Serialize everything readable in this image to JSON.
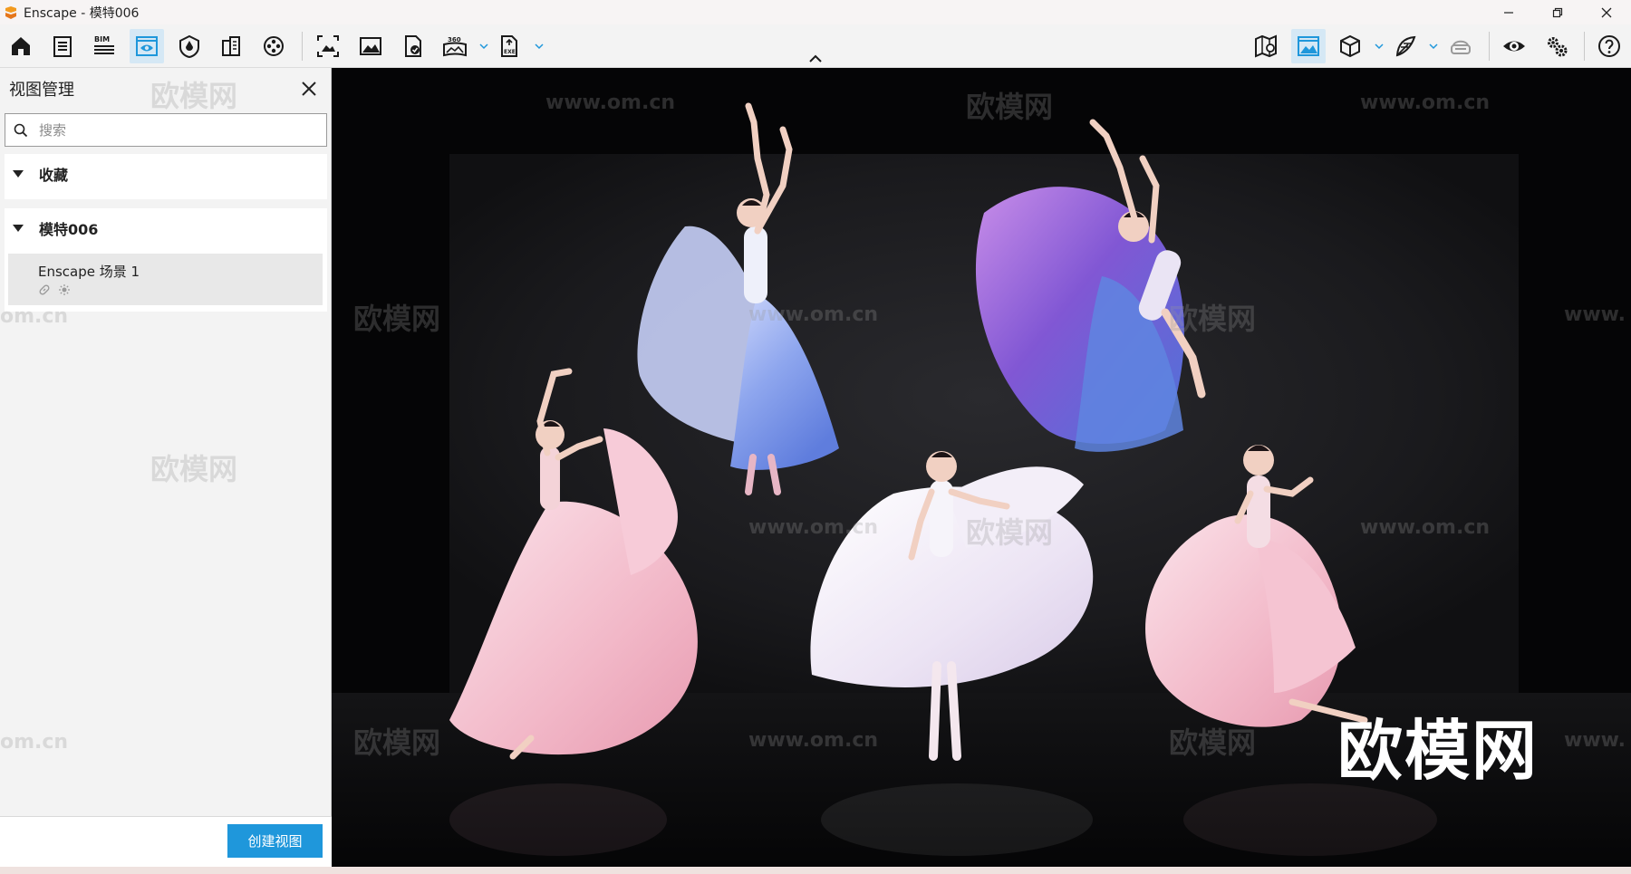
{
  "window": {
    "title": "Enscape - 模特006"
  },
  "toolbar": {
    "bim_label": "BIM",
    "pano_label": "360",
    "exe_label": "EXE",
    "accent": "#1f97db",
    "active_bg": "#d5e8f5"
  },
  "panel": {
    "title": "视图管理",
    "search_placeholder": "搜索",
    "favorites_label": "收藏",
    "model_group_label": "模特006",
    "views": [
      {
        "name": "Enscape 场景 1"
      }
    ],
    "create_button_label": "创建视图"
  },
  "watermark": {
    "brand": "欧模网",
    "url": "www.om.cn",
    "url_short": "om.cn",
    "url_partial": "www."
  }
}
